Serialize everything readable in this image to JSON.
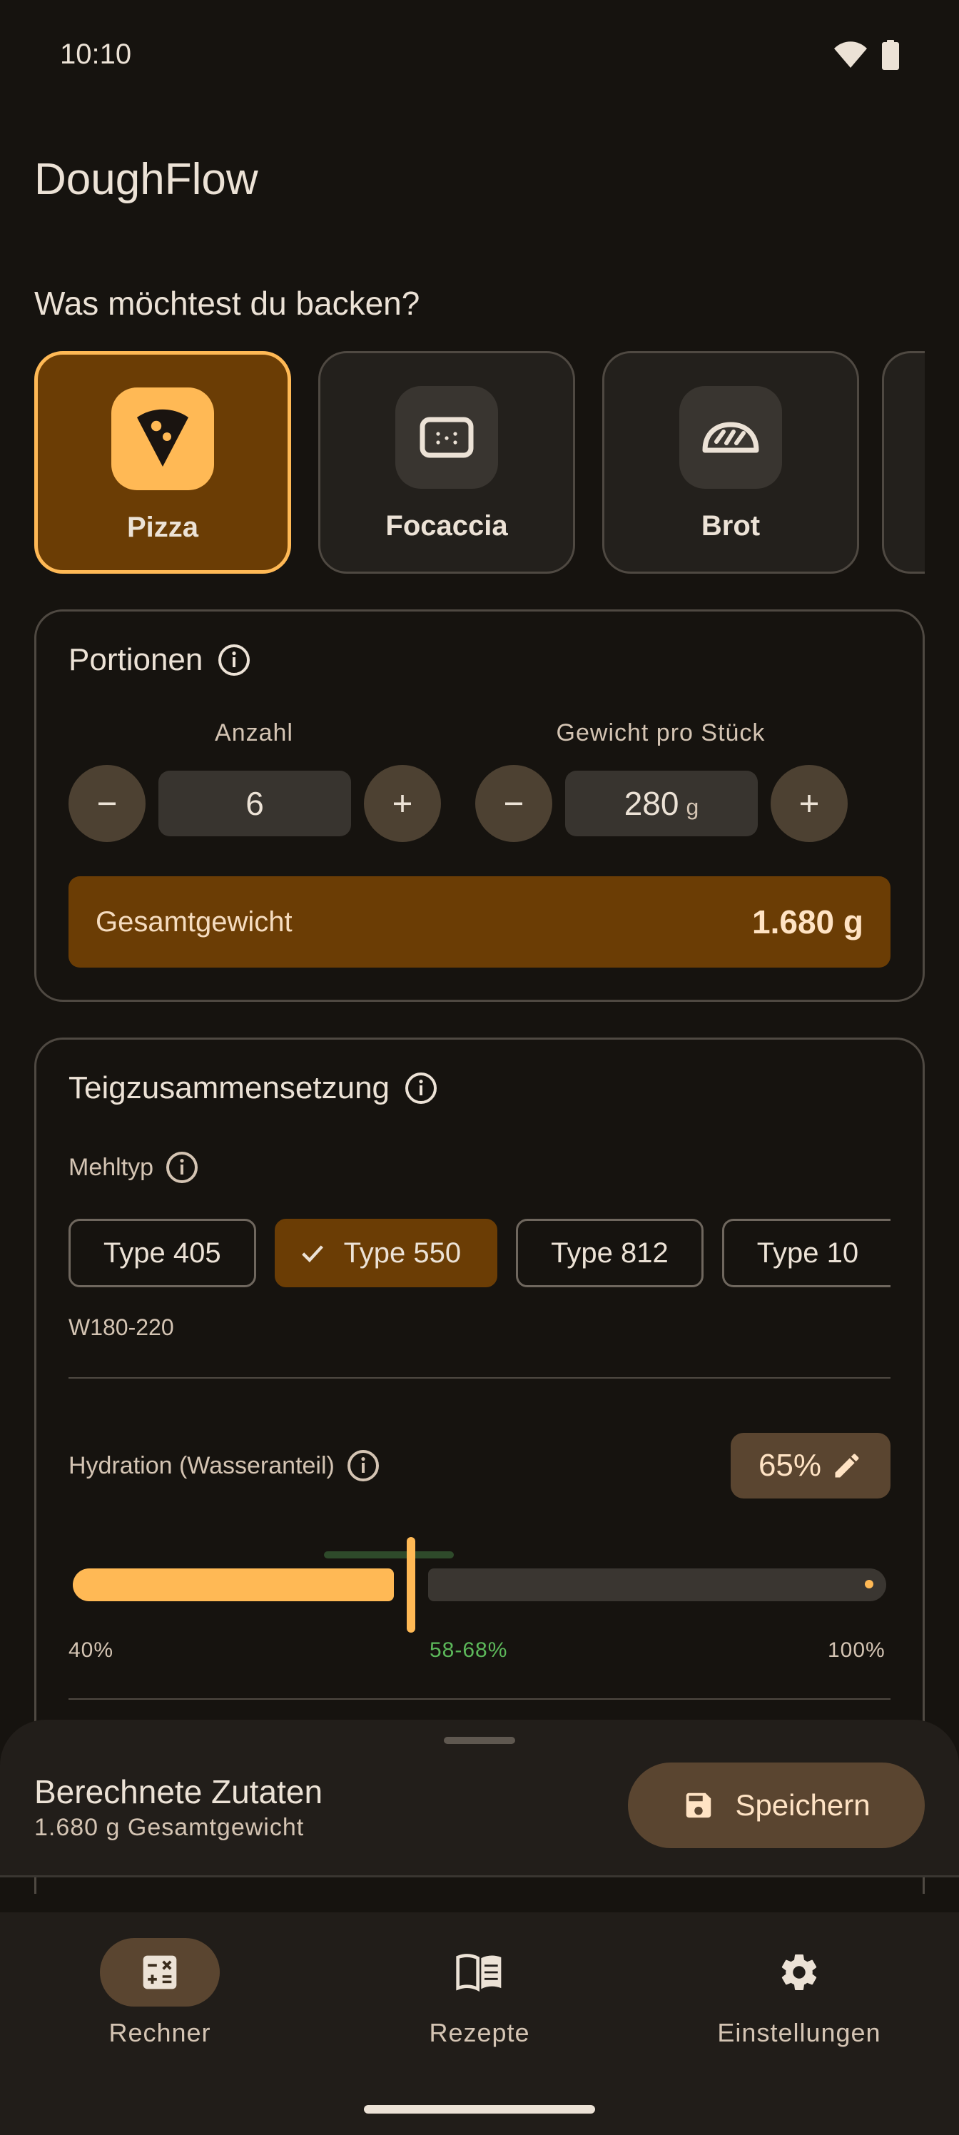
{
  "status": {
    "time": "10:10"
  },
  "app": {
    "title": "DoughFlow"
  },
  "question": "Was möchtest du backen?",
  "categories": [
    {
      "label": "Pizza",
      "icon": "pizza-icon",
      "selected": true
    },
    {
      "label": "Focaccia",
      "icon": "focaccia-icon",
      "selected": false
    },
    {
      "label": "Brot",
      "icon": "bread-icon",
      "selected": false
    }
  ],
  "portions": {
    "title": "Portionen",
    "count_label": "Anzahl",
    "count_value": "6",
    "weight_label": "Gewicht pro Stück",
    "weight_value": "280",
    "weight_unit": "g",
    "total_label": "Gesamtgewicht",
    "total_value": "1.680 g"
  },
  "dough": {
    "title": "Teigzusammensetzung",
    "flour_label": "Mehltyp",
    "flour_types": [
      "Type 405",
      "Type 550",
      "Type 812",
      "Type 10"
    ],
    "flour_selected": "Type 550",
    "flour_strength": "W180-220",
    "hydration_label": "Hydration (Wasseranteil)",
    "hydration_value": "65%",
    "hydration_fraction": 0.416,
    "slider_min": "40%",
    "slider_range": "58-68%",
    "slider_max": "100%"
  },
  "sheet": {
    "title": "Berechnete Zutaten",
    "subtitle": "1.680 g Gesamtgewicht",
    "save_label": "Speichern"
  },
  "nav": {
    "items": [
      {
        "label": "Rechner",
        "icon": "calculator-icon",
        "active": true
      },
      {
        "label": "Rezepte",
        "icon": "book-icon",
        "active": false
      },
      {
        "label": "Einstellungen",
        "icon": "gear-icon",
        "active": false
      }
    ]
  },
  "colors": {
    "accent": "#ffb955",
    "selected_bg": "#6b3d05",
    "background": "#16130f",
    "range_green": "#5cb85a"
  }
}
